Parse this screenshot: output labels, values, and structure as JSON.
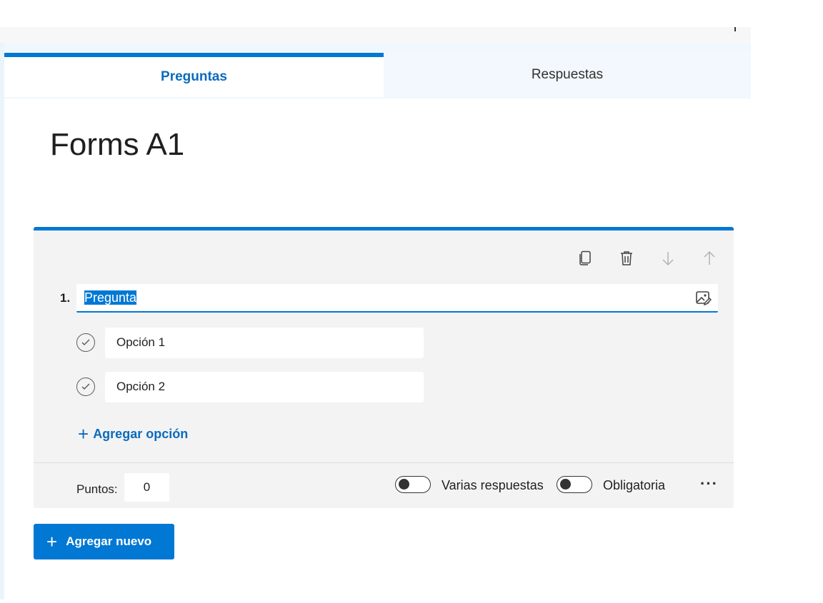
{
  "tabs": {
    "questions_label": "Preguntas",
    "responses_label": "Respuestas"
  },
  "form": {
    "title": "Forms A1"
  },
  "question": {
    "number": "1.",
    "text": "Pregunta",
    "options": [
      {
        "label": "Opción 1"
      },
      {
        "label": "Opción 2"
      }
    ],
    "add_option_label": "Agregar opción",
    "points_label": "Puntos:",
    "points_value": "0",
    "multiple_answers_label": "Varias respuestas",
    "multiple_answers_on": false,
    "required_label": "Obligatoria",
    "required_on": false,
    "more_label": "···"
  },
  "toolbar": {
    "icons": [
      "copy-icon",
      "delete-icon",
      "move-down-icon",
      "move-up-icon"
    ]
  },
  "add_new_label": "Agregar nuevo",
  "colors": {
    "accent": "#0078d4",
    "card_bg": "#f3f3f3"
  }
}
